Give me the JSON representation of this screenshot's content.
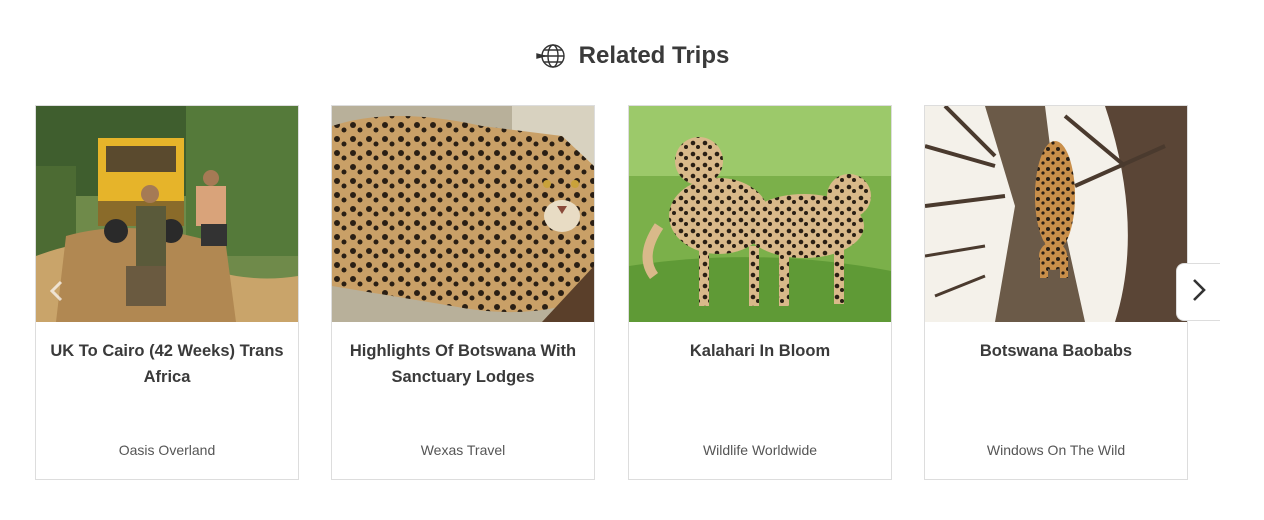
{
  "section": {
    "title": "Related Trips",
    "icon": "globe-plane-icon"
  },
  "trips": [
    {
      "title": "UK To Cairo (42 Weeks) Trans Africa",
      "operator": "Oasis Overland",
      "image": "overland-truck-jungle"
    },
    {
      "title": "Highlights Of Botswana With Sanctuary Lodges",
      "operator": "Wexas Travel",
      "image": "leopard-closeup"
    },
    {
      "title": "Kalahari In Bloom",
      "operator": "Wildlife Worldwide",
      "image": "two-leopards-grass"
    },
    {
      "title": "Botswana Baobabs",
      "operator": "Windows On The Wild",
      "image": "leopard-in-tree"
    }
  ],
  "carousel": {
    "prev_icon": "chevron-left-icon",
    "next_icon": "chevron-right-icon"
  },
  "colors": {
    "heading": "#3a3a3a",
    "border": "#dddddd",
    "operator_text": "#555555"
  }
}
